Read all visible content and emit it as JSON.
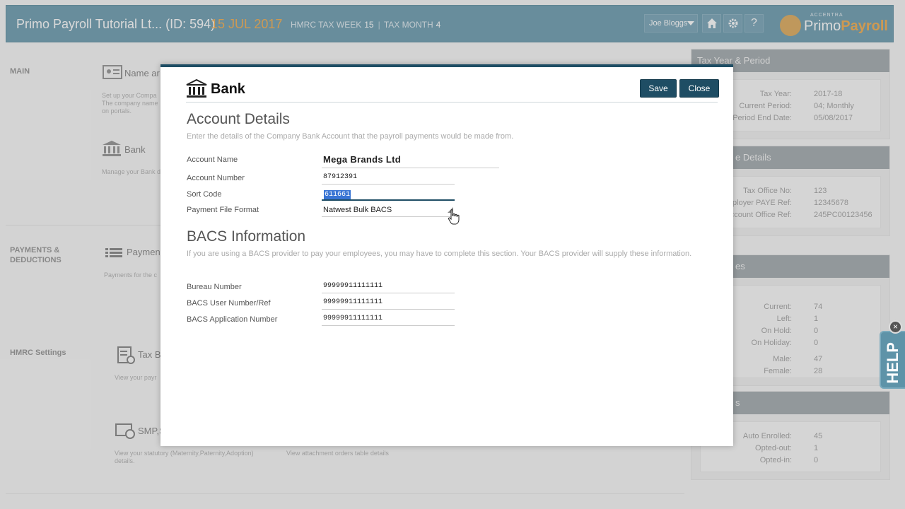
{
  "topbar": {
    "company": "Primo Payroll Tutorial Lt... (ID: 594)",
    "date": "15 JUL 2017",
    "tax_week_label": "HMRC TAX WEEK",
    "tax_week_value": "15",
    "tax_month_label": "TAX MONTH",
    "tax_month_value": "4",
    "user": "Joe Bloggs",
    "logo_small": "ACCENTRA",
    "logo_primo": "Primo",
    "logo_payroll": "Payroll"
  },
  "background": {
    "main_label": "MAIN",
    "name_title": "Name ar",
    "name_desc": "Set up your Compa\nThe company name\non portals.",
    "bank_title": "Bank",
    "bank_desc": "Manage your Bank d",
    "payments_label": "PAYMENTS &\nDEDUCTIONS",
    "payments_title": "Paymen",
    "payments_desc": "Payments for the c",
    "hmrc_label": "HMRC Settings",
    "tax_title": "Tax B",
    "tax_desc": "View your payr",
    "smp_title": "SMP,S",
    "smp_desc": "View your statutory (Maternity,Paternity,Adoption)\ndetails.",
    "attach_desc": "View attachment orders table details"
  },
  "panels": {
    "tax_year": {
      "title": "Tax Year & Period",
      "rows": [
        {
          "k": "Tax Year:",
          "v": "2017-18"
        },
        {
          "k": "Current Period:",
          "v": "04; Monthly"
        },
        {
          "k": "Period End Date:",
          "v": "05/08/2017"
        }
      ]
    },
    "office": {
      "title": "e Details",
      "rows": [
        {
          "k": "Tax Office No:",
          "v": "123"
        },
        {
          "k": "Employer PAYE Ref:",
          "v": "12345678"
        },
        {
          "k": "Account Office Ref:",
          "v": "245PC00123456"
        }
      ]
    },
    "employees": {
      "title": "es",
      "rows": [
        {
          "k": "Current:",
          "v": "74"
        },
        {
          "k": "Left:",
          "v": "1"
        },
        {
          "k": "On Hold:",
          "v": "0"
        },
        {
          "k": "On Holiday:",
          "v": "0"
        },
        {
          "k": "Male:",
          "v": "47"
        },
        {
          "k": "Female:",
          "v": "28"
        }
      ]
    },
    "pension": {
      "title": "s",
      "rows": [
        {
          "k": "Auto Enrolled:",
          "v": "45"
        },
        {
          "k": "Opted-out:",
          "v": "1"
        },
        {
          "k": "Opted-in:",
          "v": "0"
        }
      ]
    }
  },
  "help": {
    "label": "HELP",
    "close": "×"
  },
  "modal": {
    "title": "Bank",
    "save_label": "Save",
    "close_label": "Close",
    "account_section_title": "Account Details",
    "account_section_desc": "Enter the details of the Company Bank Account that the payroll payments would be made from.",
    "fields": {
      "account_name_label": "Account Name",
      "account_name_value": "Mega Brands Ltd",
      "account_number_label": "Account Number",
      "account_number_value": "87912391",
      "sort_code_label": "Sort Code",
      "sort_code_value": "611661",
      "payment_format_label": "Payment File Format",
      "payment_format_value": "Natwest Bulk BACS"
    },
    "bacs_section_title": "BACS Information",
    "bacs_section_desc": "If you are using a BACS provider to pay your employees, you may have to complete this section. Your BACS provider will supply these information.",
    "bacs": {
      "bureau_label": "Bureau Number",
      "bureau_value": "99999911111111",
      "user_ref_label": "BACS User Number/Ref",
      "user_ref_value": "99999911111111",
      "app_number_label": "BACS Application Number",
      "app_number_value": "99999911111111"
    }
  }
}
